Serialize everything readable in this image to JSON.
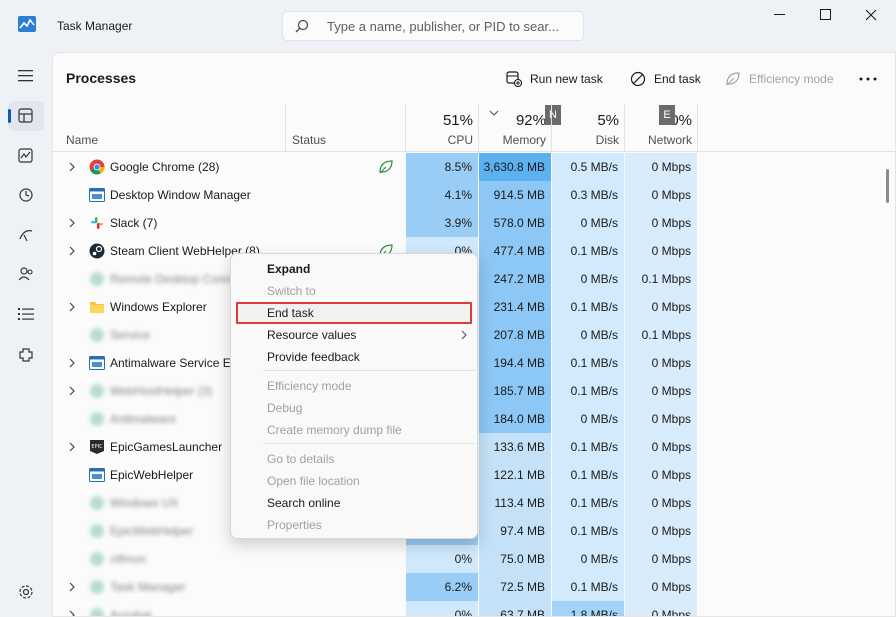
{
  "window": {
    "title": "Task Manager"
  },
  "search": {
    "placeholder": "Type a name, publisher, or PID to sear..."
  },
  "nav": {
    "items": [
      {
        "icon": "hamburger-icon",
        "label": "Menu"
      },
      {
        "icon": "processes-icon",
        "label": "Processes",
        "active": true
      },
      {
        "icon": "performance-icon",
        "label": "Performance"
      },
      {
        "icon": "app-history-icon",
        "label": "App history"
      },
      {
        "icon": "startup-apps-icon",
        "label": "Startup apps"
      },
      {
        "icon": "users-icon",
        "label": "Users"
      },
      {
        "icon": "details-icon",
        "label": "Details"
      },
      {
        "icon": "services-icon",
        "label": "Services"
      },
      {
        "icon": "settings-icon",
        "label": "Settings"
      }
    ]
  },
  "toolbar": {
    "title": "Processes",
    "run_new_task": "Run new task",
    "end_task": "End task",
    "efficiency_mode": "Efficiency mode"
  },
  "columns": {
    "name": "Name",
    "status": "Status",
    "cpu": {
      "pct": "51%",
      "label": "CPU"
    },
    "memory": {
      "pct": "92%",
      "label": "Memory",
      "tag": "N"
    },
    "disk": {
      "pct": "5%",
      "label": "Disk"
    },
    "network": {
      "pct": "0%",
      "label": "Network",
      "tag": "E"
    }
  },
  "rows": [
    {
      "name": "Google Chrome (28)",
      "expand": true,
      "icon": "chrome-icon",
      "leaf": true,
      "cpu": "8.5%",
      "mem": "3,630.8 MB",
      "disk": "0.5 MB/s",
      "net": "0 Mbps",
      "blur": false
    },
    {
      "name": "Desktop Window Manager",
      "expand": false,
      "icon": "dwm-icon",
      "leaf": false,
      "cpu": "4.1%",
      "mem": "914.5 MB",
      "disk": "0.3 MB/s",
      "net": "0 Mbps",
      "blur": false
    },
    {
      "name": "Slack (7)",
      "expand": true,
      "icon": "slack-icon",
      "leaf": false,
      "cpu": "3.9%",
      "mem": "578.0 MB",
      "disk": "0 MB/s",
      "net": "0 Mbps",
      "blur": false
    },
    {
      "name": "Steam Client WebHelper (8)",
      "expand": true,
      "icon": "steam-icon",
      "leaf": true,
      "cpu": "0%",
      "mem": "477.4 MB",
      "disk": "0.1 MB/s",
      "net": "0 Mbps",
      "blur": false
    },
    {
      "name": "Remote Desktop Connection",
      "expand": false,
      "icon": "generic-icon",
      "leaf": false,
      "cpu": "",
      "mem": "247.2 MB",
      "disk": "0 MB/s",
      "net": "0.1 Mbps",
      "blur": true
    },
    {
      "name": "Windows Explorer",
      "expand": true,
      "icon": "folder-icon",
      "leaf": false,
      "cpu": "",
      "mem": "231.4 MB",
      "disk": "0.1 MB/s",
      "net": "0 Mbps",
      "blur": false
    },
    {
      "name": "Service",
      "expand": false,
      "icon": "generic-icon",
      "leaf": false,
      "cpu": "",
      "mem": "207.8 MB",
      "disk": "0 MB/s",
      "net": "0.1 Mbps",
      "blur": true
    },
    {
      "name": "Antimalware Service Executable",
      "expand": true,
      "icon": "dwm-icon",
      "leaf": false,
      "cpu": "",
      "mem": "194.4 MB",
      "disk": "0.1 MB/s",
      "net": "0 Mbps",
      "blur": false
    },
    {
      "name": "WebHostHelper (3)",
      "expand": true,
      "icon": "generic-icon",
      "leaf": false,
      "cpu": "",
      "mem": "185.7 MB",
      "disk": "0.1 MB/s",
      "net": "0 Mbps",
      "blur": true
    },
    {
      "name": "Antimalware",
      "expand": false,
      "icon": "generic-icon",
      "leaf": false,
      "cpu": "",
      "mem": "184.0 MB",
      "disk": "0 MB/s",
      "net": "0 Mbps",
      "blur": true
    },
    {
      "name": "EpicGamesLauncher",
      "expand": true,
      "icon": "epic-icon",
      "leaf": false,
      "cpu": "",
      "mem": "133.6 MB",
      "disk": "0.1 MB/s",
      "net": "0 Mbps",
      "blur": false
    },
    {
      "name": "EpicWebHelper",
      "expand": false,
      "icon": "dwm-icon",
      "leaf": false,
      "cpu": "",
      "mem": "122.1 MB",
      "disk": "0.1 MB/s",
      "net": "0 Mbps",
      "blur": false
    },
    {
      "name": "Windows UX",
      "expand": false,
      "icon": "generic-icon",
      "leaf": false,
      "cpu": "",
      "mem": "113.4 MB",
      "disk": "0.1 MB/s",
      "net": "0 Mbps",
      "blur": true
    },
    {
      "name": "EpicWebHelper",
      "expand": false,
      "icon": "generic-icon",
      "leaf": false,
      "cpu": "",
      "mem": "97.4 MB",
      "disk": "0.1 MB/s",
      "net": "0 Mbps",
      "blur": true
    },
    {
      "name": "ctfmon",
      "expand": false,
      "icon": "generic-icon",
      "leaf": false,
      "cpu": "0%",
      "mem": "75.0 MB",
      "disk": "0 MB/s",
      "net": "0 Mbps",
      "blur": true
    },
    {
      "name": "Task Manager",
      "expand": true,
      "icon": "generic-icon",
      "leaf": false,
      "cpu": "6.2%",
      "mem": "72.5 MB",
      "disk": "0.1 MB/s",
      "net": "0 Mbps",
      "blur": true
    },
    {
      "name": "Acrobat",
      "expand": true,
      "icon": "generic-icon",
      "leaf": false,
      "cpu": "0%",
      "mem": "63.7 MB",
      "disk": "1.8 MB/s",
      "net": "0 Mbps",
      "blur": true
    }
  ],
  "context_menu": {
    "items": [
      {
        "label": "Expand",
        "state": "bold"
      },
      {
        "label": "Switch to",
        "state": "disabled"
      },
      {
        "label": "End task",
        "state": "highlighted"
      },
      {
        "label": "Resource values",
        "state": "submenu"
      },
      {
        "label": "Provide feedback",
        "state": "normal"
      },
      {
        "label": "Efficiency mode",
        "state": "disabled"
      },
      {
        "label": "Debug",
        "state": "disabled"
      },
      {
        "label": "Create memory dump file",
        "state": "disabled"
      },
      {
        "label": "Go to details",
        "state": "disabled"
      },
      {
        "label": "Open file location",
        "state": "disabled"
      },
      {
        "label": "Search online",
        "state": "normal"
      },
      {
        "label": "Properties",
        "state": "disabled"
      }
    ]
  },
  "colors": {
    "cpu_high": "#99cdf6",
    "cpu_low": "#d0e8fb",
    "mem_high": "#5cb1f1",
    "mem_mid": "#8cc7f5",
    "mem_low": "#c4e1f8",
    "disk_mid": "#a3d3f7",
    "disk_low": "#d3eafc",
    "net_low": "#d8ecfc",
    "accent": "#0a5fb4",
    "highlight_border": "#e0393e"
  }
}
